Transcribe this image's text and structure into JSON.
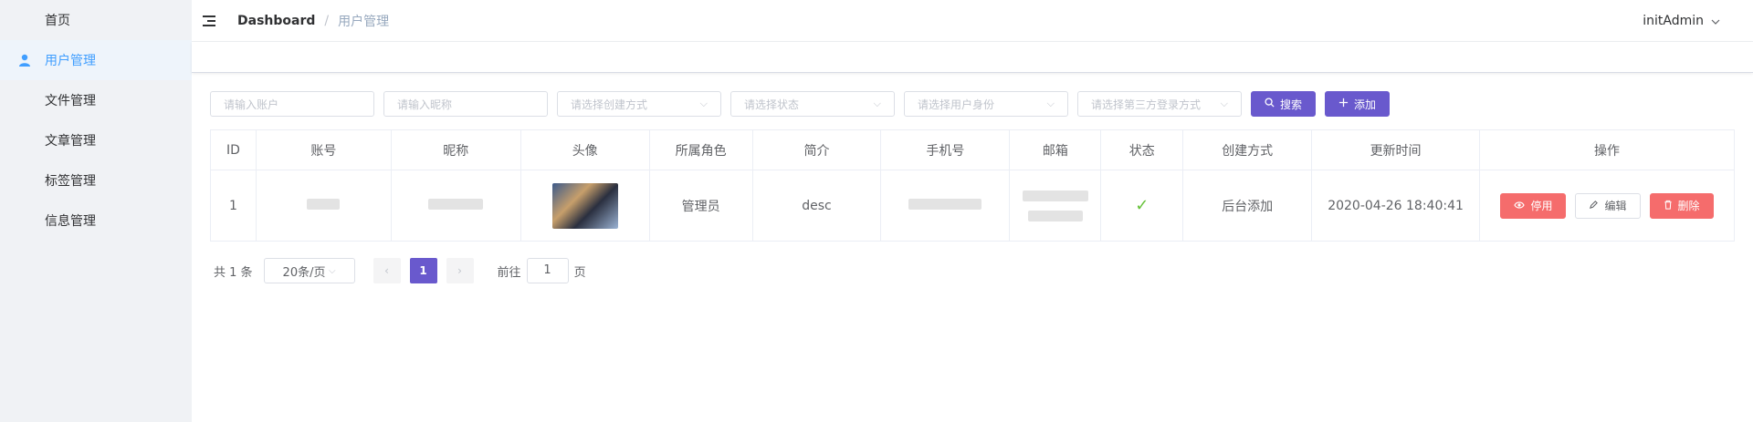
{
  "sidebar": {
    "items": [
      {
        "label": "首页",
        "icon": "grid-icon"
      },
      {
        "label": "用户管理",
        "icon": "user-icon",
        "active": true
      },
      {
        "label": "文件管理",
        "icon": "grid-icon"
      },
      {
        "label": "文章管理",
        "icon": "grid-icon"
      },
      {
        "label": "标签管理",
        "icon": "grid-icon"
      },
      {
        "label": "信息管理",
        "icon": "grid-icon"
      }
    ]
  },
  "navbar": {
    "breadcrumb_root": "Dashboard",
    "breadcrumb_sep": "/",
    "breadcrumb_current": "用户管理",
    "user": "initAdmin"
  },
  "filters": {
    "account_placeholder": "请输入账户",
    "nickname_placeholder": "请输入昵称",
    "create_method_placeholder": "请选择创建方式",
    "status_placeholder": "请选择状态",
    "identity_placeholder": "请选择用户身份",
    "third_party_placeholder": "请选择第三方登录方式",
    "search_label": "搜索",
    "add_label": "添加"
  },
  "table": {
    "headers": [
      "ID",
      "账号",
      "昵称",
      "头像",
      "所属角色",
      "简介",
      "手机号",
      "邮箱",
      "状态",
      "创建方式",
      "更新时间",
      "操作"
    ],
    "rows": [
      {
        "id": "1",
        "role": "管理员",
        "desc": "desc",
        "create_method": "后台添加",
        "updated_at": "2020-04-26 18:40:41",
        "status": "✓"
      }
    ],
    "actions": {
      "disable": "停用",
      "edit": "编辑",
      "delete": "删除"
    }
  },
  "pagination": {
    "total": "共 1 条",
    "page_size": "20条/页",
    "current_page": "1",
    "goto_prefix": "前往",
    "goto_value": "1",
    "goto_suffix": "页"
  },
  "colors": {
    "primary": "#6959cd",
    "danger": "#f56c6c",
    "active_menu": "#409eff",
    "success": "#67c23a"
  }
}
